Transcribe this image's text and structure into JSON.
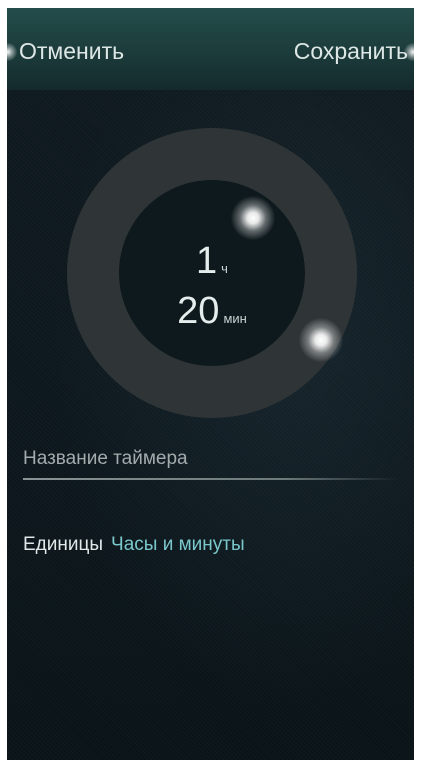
{
  "header": {
    "cancel_label": "Отменить",
    "save_label": "Сохранить"
  },
  "timer": {
    "hours_value": "1",
    "hours_unit": "ч",
    "minutes_value": "20",
    "minutes_unit": "мин"
  },
  "name_field": {
    "placeholder": "Название таймера",
    "value": ""
  },
  "units": {
    "label": "Единицы",
    "value": "Часы и минуты"
  },
  "colors": {
    "header": "#1c3b3b",
    "background": "#0d181e",
    "dial_ring": "#2f3537",
    "accent": "#7ac7cc"
  }
}
